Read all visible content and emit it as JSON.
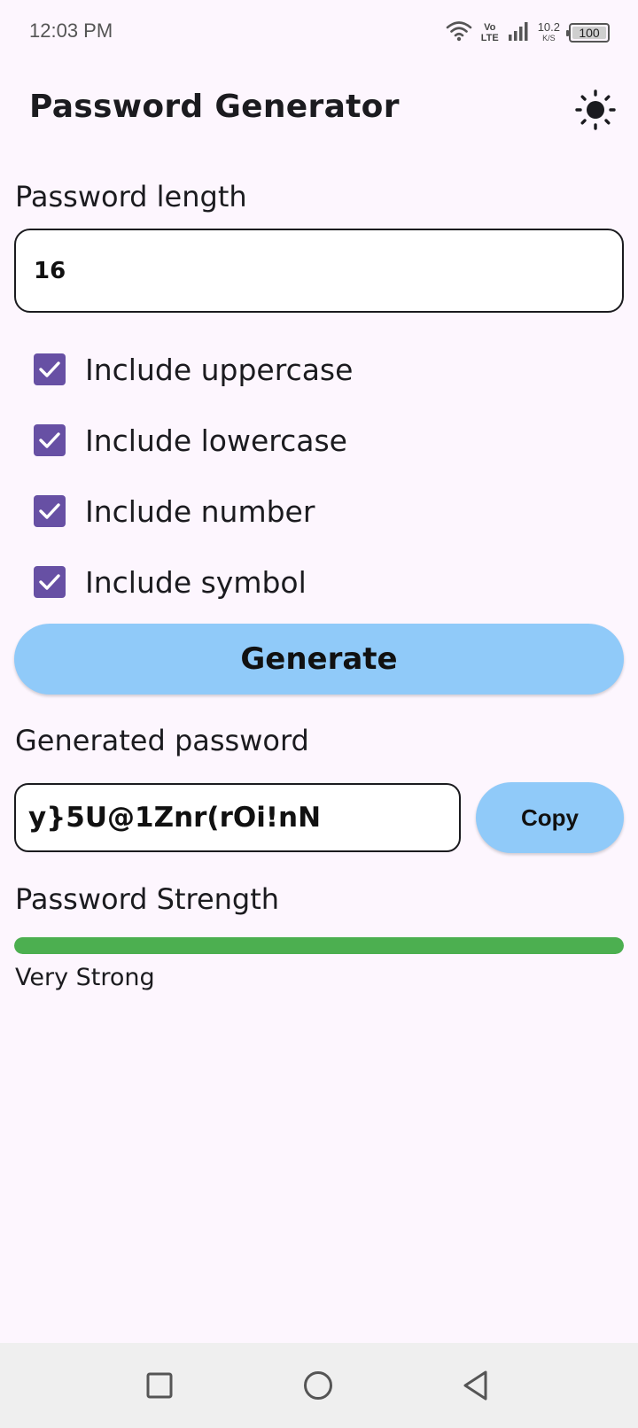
{
  "status_bar": {
    "time": "12:03 PM",
    "volte_top": "Vo",
    "volte_bottom": "LTE",
    "speed_value": "10.2",
    "speed_unit": "K/S",
    "battery": "100"
  },
  "app_bar": {
    "title": "Password Generator",
    "theme_icon": "sun-icon"
  },
  "length_section": {
    "label": "Password length",
    "value": "16"
  },
  "options": [
    {
      "label": "Include uppercase",
      "checked": true
    },
    {
      "label": "Include lowercase",
      "checked": true
    },
    {
      "label": "Include number",
      "checked": true
    },
    {
      "label": "Include symbol",
      "checked": true
    }
  ],
  "generate_button": {
    "label": "Generate"
  },
  "generated_section": {
    "label": "Generated password",
    "password": "y}5U@1Znr(rOi!nN",
    "copy_label": "Copy"
  },
  "strength_section": {
    "label": "Password Strength",
    "level_fraction": 1.0,
    "text": "Very Strong",
    "color": "#4caf50"
  },
  "colors": {
    "accent": "#6750a4",
    "button": "#90caf9",
    "background": "#fdf6fe"
  },
  "nav_bar": {
    "icons": [
      "recent-apps-icon",
      "home-icon",
      "back-icon"
    ]
  }
}
